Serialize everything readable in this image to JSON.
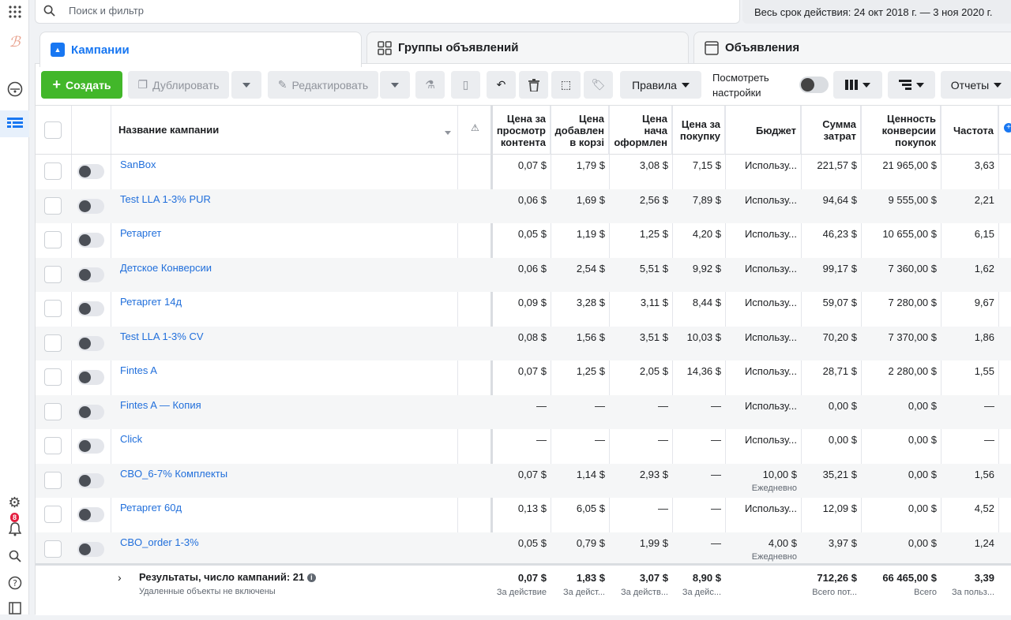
{
  "search": {
    "placeholder": "Поиск и фильтр"
  },
  "date_range": "Весь срок действия: 24 окт 2018 г. — 3 ноя 2020 г.",
  "tabs": [
    {
      "label": "Кампании",
      "active": true
    },
    {
      "label": "Группы объявлений",
      "active": false
    },
    {
      "label": "Объявления",
      "active": false
    }
  ],
  "toolbar": {
    "create": "Создать",
    "duplicate": "Дублировать",
    "edit": "Редактировать",
    "rules": "Правила",
    "settings_line1": "Посмотреть",
    "settings_line2": "настройки",
    "reports": "Отчеты"
  },
  "notifications_count": "8",
  "columns": {
    "name": "Название кампании",
    "view_line1": "Цена за",
    "view_line2": "просмотр",
    "view_line3": "контента",
    "cart_line1": "Цена",
    "cart_line2": "добавлен",
    "cart_line3": "в корзі",
    "checkout_line1": "Цена",
    "checkout_line2": "нача",
    "checkout_line3": "оформлен",
    "purchase_line1": "Цена за",
    "purchase_line2": "покупку",
    "budget": "Бюджет",
    "spend_line1": "Сумма",
    "spend_line2": "затрат",
    "value_line1": "Ценность",
    "value_line2": "конверсии",
    "value_line3": "покупок",
    "frequency": "Частота"
  },
  "rows": [
    {
      "name": "SanBox",
      "view": "0,07 $",
      "cart": "1,79 $",
      "checkout": "3,08 $",
      "purchase": "7,15 $",
      "budget": "Использу...",
      "budget_sub": "",
      "spend": "221,57 $",
      "value": "21 965,00 $",
      "freq": "3,63"
    },
    {
      "name": "Test LLA 1-3% PUR",
      "view": "0,06 $",
      "cart": "1,69 $",
      "checkout": "2,56 $",
      "purchase": "7,89 $",
      "budget": "Использу...",
      "budget_sub": "",
      "spend": "94,64 $",
      "value": "9 555,00 $",
      "freq": "2,21"
    },
    {
      "name": "Ретаргет",
      "view": "0,05 $",
      "cart": "1,19 $",
      "checkout": "1,25 $",
      "purchase": "4,20 $",
      "budget": "Использу...",
      "budget_sub": "",
      "spend": "46,23 $",
      "value": "10 655,00 $",
      "freq": "6,15"
    },
    {
      "name": "Детское Конверсии",
      "view": "0,06 $",
      "cart": "2,54 $",
      "checkout": "5,51 $",
      "purchase": "9,92 $",
      "budget": "Использу...",
      "budget_sub": "",
      "spend": "99,17 $",
      "value": "7 360,00 $",
      "freq": "1,62"
    },
    {
      "name": "Ретаргет 14д",
      "view": "0,09 $",
      "cart": "3,28 $",
      "checkout": "3,11 $",
      "purchase": "8,44 $",
      "budget": "Использу...",
      "budget_sub": "",
      "spend": "59,07 $",
      "value": "7 280,00 $",
      "freq": "9,67"
    },
    {
      "name": "Test LLA 1-3% CV",
      "view": "0,08 $",
      "cart": "1,56 $",
      "checkout": "3,51 $",
      "purchase": "10,03 $",
      "budget": "Использу...",
      "budget_sub": "",
      "spend": "70,20 $",
      "value": "7 370,00 $",
      "freq": "1,86"
    },
    {
      "name": "Fintes A",
      "view": "0,07 $",
      "cart": "1,25 $",
      "checkout": "2,05 $",
      "purchase": "14,36 $",
      "budget": "Использу...",
      "budget_sub": "",
      "spend": "28,71 $",
      "value": "2 280,00 $",
      "freq": "1,55"
    },
    {
      "name": "Fintes A — Копия",
      "view": "—",
      "cart": "—",
      "checkout": "—",
      "purchase": "—",
      "budget": "Использу...",
      "budget_sub": "",
      "spend": "0,00 $",
      "value": "0,00 $",
      "freq": "—"
    },
    {
      "name": "Click",
      "view": "—",
      "cart": "—",
      "checkout": "—",
      "purchase": "—",
      "budget": "Использу...",
      "budget_sub": "",
      "spend": "0,00 $",
      "value": "0,00 $",
      "freq": "—"
    },
    {
      "name": "CBO_6-7% Комплекты",
      "view": "0,07 $",
      "cart": "1,14 $",
      "checkout": "2,93 $",
      "purchase": "—",
      "budget": "10,00 $",
      "budget_sub": "Ежедневно",
      "spend": "35,21 $",
      "value": "0,00 $",
      "freq": "1,56"
    },
    {
      "name": "Ретаргет 60д",
      "view": "0,13 $",
      "cart": "6,05 $",
      "checkout": "—",
      "purchase": "—",
      "budget": "Использу...",
      "budget_sub": "",
      "spend": "12,09 $",
      "value": "0,00 $",
      "freq": "4,52"
    },
    {
      "name": "CBO_order 1-3%",
      "view": "0,05 $",
      "cart": "0,79 $",
      "checkout": "1,99 $",
      "purchase": "—",
      "budget": "4,00 $",
      "budget_sub": "Ежедневно",
      "spend": "3,97 $",
      "value": "0,00 $",
      "freq": "1,24"
    }
  ],
  "footer": {
    "title": "Результаты, число кампаний: 21",
    "subtitle": "Удаленные объекты не включены",
    "view": "0,07 $",
    "view_note": "За действие",
    "cart": "1,83 $",
    "cart_note": "За дейст...",
    "checkout": "3,07 $",
    "checkout_note": "За действ...",
    "purchase": "8,90 $",
    "purchase_note": "За дейс...",
    "spend": "712,26 $",
    "spend_note": "Всего пот...",
    "value": "66 465,00 $",
    "value_note": "Всего",
    "freq": "3,39",
    "freq_note": "За польз..."
  },
  "colors": {
    "accent": "#1877f2",
    "create": "#42b72a",
    "link": "#216fdb"
  }
}
